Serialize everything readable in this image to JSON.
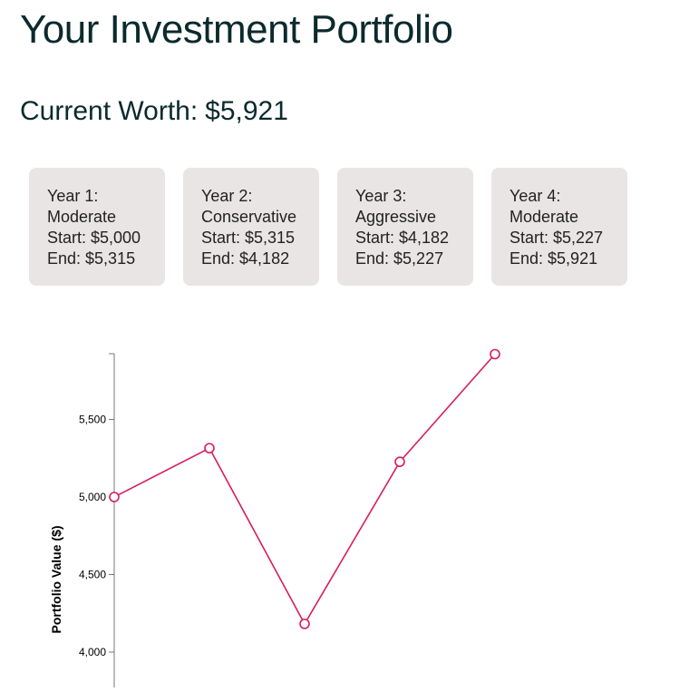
{
  "title": "Your Investment Portfolio",
  "current_worth": {
    "label": "Current Worth:",
    "value": "$5,921"
  },
  "years": [
    {
      "heading": "Year 1:",
      "strategy": "Moderate",
      "start": "Start: $5,000",
      "end": "End: $5,315"
    },
    {
      "heading": "Year 2:",
      "strategy": "Conservative",
      "start": "Start: $5,315",
      "end": "End: $4,182"
    },
    {
      "heading": "Year 3:",
      "strategy": "Aggressive",
      "start": "Start: $4,182",
      "end": "End: $5,227"
    },
    {
      "heading": "Year 4:",
      "strategy": "Moderate",
      "start": "Start: $5,227",
      "end": "End: $5,921"
    }
  ],
  "colors": {
    "line": "#d81b60",
    "axis": "#777777",
    "card_bg": "#e8e5e4"
  },
  "chart_data": {
    "type": "line",
    "title": "",
    "xlabel": "",
    "ylabel": "Portfolio Value ($)",
    "x": [
      0,
      1,
      2,
      3,
      4
    ],
    "values": [
      5000,
      5315,
      4182,
      5227,
      5921
    ],
    "ylim": [
      3950,
      6000
    ],
    "yticks": [
      4000,
      4500,
      5000,
      5500
    ],
    "ytick_labels": [
      "4,000",
      "4,500",
      "5,000",
      "5,500"
    ],
    "grid": false,
    "markers": "hollow-circle"
  }
}
